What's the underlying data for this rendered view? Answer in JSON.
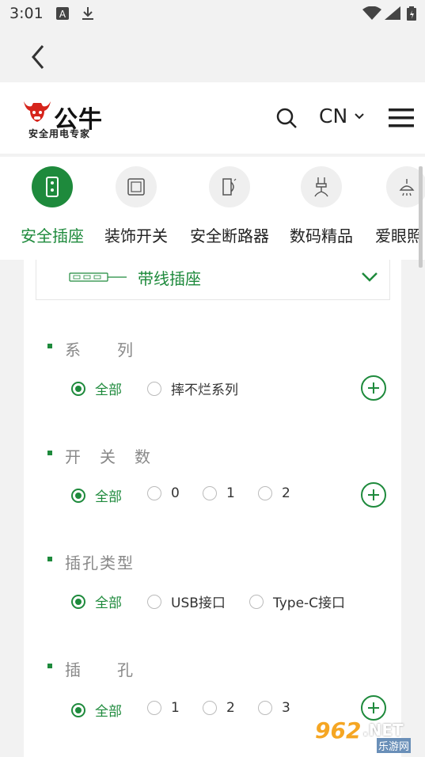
{
  "status_bar": {
    "time": "3:01"
  },
  "header": {
    "brand": "公牛",
    "slogan": "安全用电专家",
    "language": "CN"
  },
  "categories": [
    {
      "label": "安全插座",
      "icon": "power-strip-icon",
      "active": true
    },
    {
      "label": "装饰开关",
      "icon": "wall-switch-icon",
      "active": false
    },
    {
      "label": "安全断路器",
      "icon": "circuit-breaker-icon",
      "active": false
    },
    {
      "label": "数码精品",
      "icon": "cable-icon",
      "active": false
    },
    {
      "label": "爱眼照",
      "icon": "lamp-icon",
      "active": false
    }
  ],
  "dropdown": {
    "label": "带线插座",
    "icon": "power-strip-icon"
  },
  "filters": [
    {
      "title": "系　　列",
      "options": [
        "全部",
        "摔不烂系列"
      ],
      "selected": "全部"
    },
    {
      "title": "开　关　数",
      "options": [
        "全部",
        "0",
        "1",
        "2"
      ],
      "selected": "全部"
    },
    {
      "title": "插孔类型",
      "options": [
        "全部",
        "USB接口",
        "Type-C接口"
      ],
      "selected": "全部"
    },
    {
      "title": "插　　孔",
      "options": [
        "全部",
        "1",
        "2",
        "3"
      ],
      "selected": "全部"
    }
  ],
  "watermark": {
    "number": "962",
    "net": ".NET",
    "sub": "乐游网"
  },
  "colors": {
    "accent": "#1e8a3c",
    "background": "#f2f2f2"
  }
}
